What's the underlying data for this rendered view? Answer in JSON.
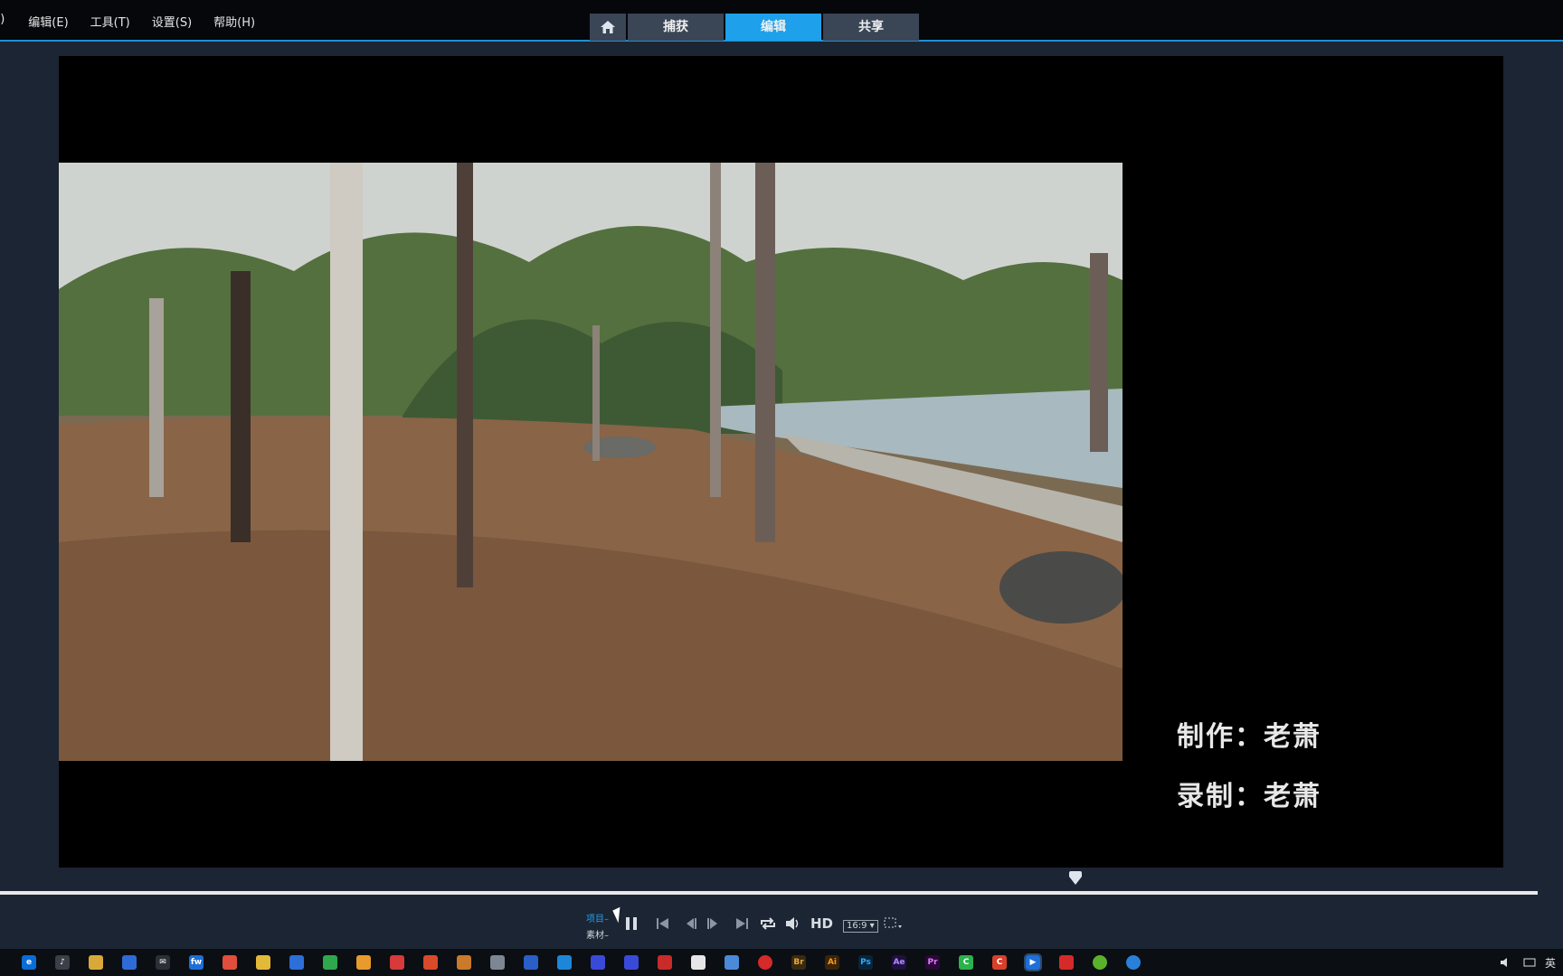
{
  "menu": {
    "partial_left": "E)",
    "items": [
      {
        "label": "编辑(E)"
      },
      {
        "label": "工具(T)"
      },
      {
        "label": "设置(S)"
      },
      {
        "label": "帮助(H)"
      }
    ]
  },
  "tabs": {
    "home_icon": "home-icon",
    "items": [
      {
        "label": "捕获",
        "active": false
      },
      {
        "label": "编辑",
        "active": true
      },
      {
        "label": "共享",
        "active": false
      }
    ]
  },
  "preview": {
    "credits": [
      "制作：老萧",
      "录制：老萧"
    ]
  },
  "playback": {
    "mode_project": "项目",
    "mode_clip": "素材",
    "hd_label": "HD",
    "aspect_label": "16:9",
    "controls": [
      "pause-icon",
      "to-start-icon",
      "prev-frame-icon",
      "next-frame-icon",
      "to-end-icon",
      "repeat-icon",
      "volume-icon"
    ]
  },
  "colors": {
    "accent": "#1ea0ea",
    "tab_inactive": "#3a4556",
    "background": "#1c2533"
  },
  "taskbar": {
    "tray_ime": "英"
  }
}
